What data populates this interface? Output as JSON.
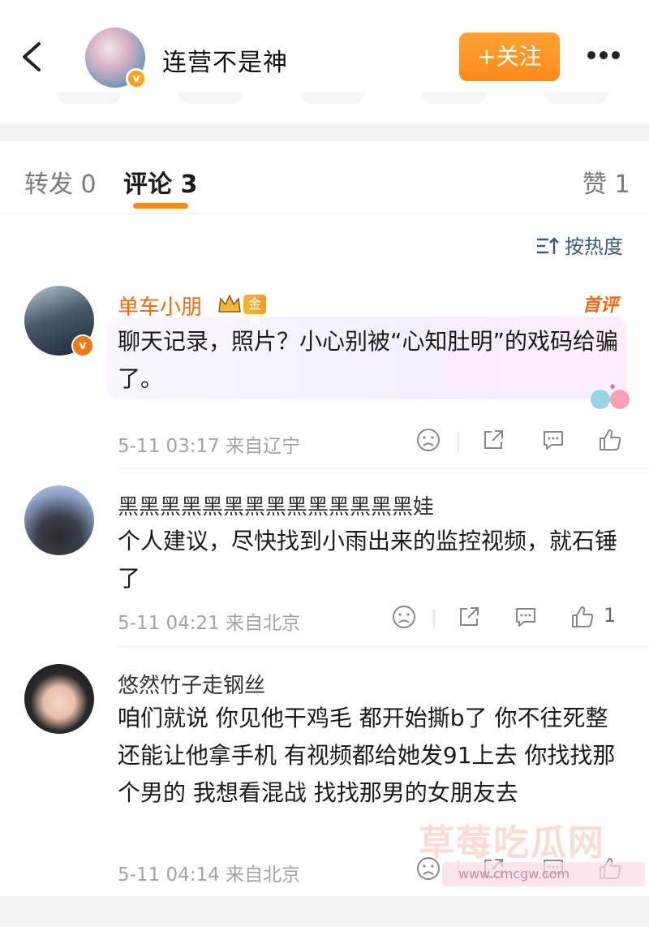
{
  "header": {
    "title": "连营不是神",
    "follow_label": "+关注",
    "verified_badge": "v"
  },
  "tabs": [
    {
      "label": "转发 0"
    },
    {
      "label": "评论 3"
    },
    {
      "label": "赞 1"
    }
  ],
  "sort_label": "按热度",
  "comments": [
    {
      "username": "单车小朋",
      "fan_badge": "金粉3",
      "tag": "首评",
      "text": "聊天记录，照片？小心别被“心知肚明”的戏码给骗了。",
      "meta": "5-11 03:17 来自辽宁",
      "likes": ""
    },
    {
      "username": "黑黑黑黑黑黑黑黑黑黑黑黑黑黑娃",
      "text": "个人建议，尽快找到小雨出来的监控视频，就石锤了",
      "meta": "5-11 04:21 来自北京",
      "likes": "1"
    },
    {
      "username": "悠然竹子走钢丝",
      "text": "咱们就说 你见他干鸡毛 都开始撕b了 你不往死整 还能让他拿手机 有视频都给她发91上去 你找找那个男的 我想看混战 找找那男的女朋友去",
      "meta": "5-11 04:14 来自北京",
      "likes": ""
    }
  ],
  "watermark": {
    "text": "草莓吃瓜网",
    "url": "www.cmcgw.com"
  },
  "colors": {
    "accent": "#ff8a1a",
    "orange_name": "#f06a14",
    "link_blue": "#3a5a80"
  }
}
